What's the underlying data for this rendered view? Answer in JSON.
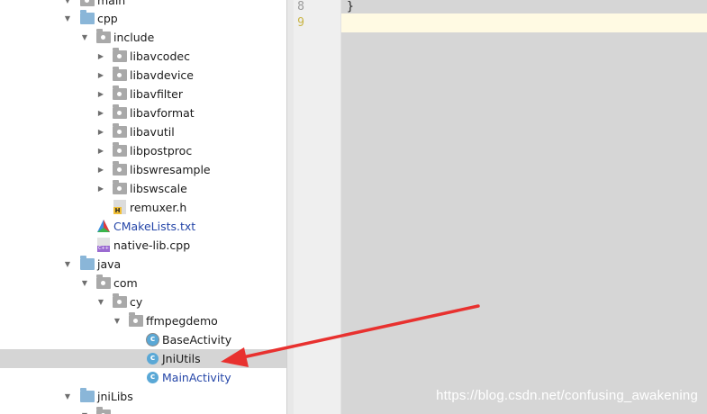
{
  "project_tree": {
    "items": [
      {
        "label": "main",
        "icon": "folder-gray-icon",
        "expanded": true
      },
      {
        "label": "cpp",
        "icon": "folder-blue-icon",
        "expanded": true
      },
      {
        "label": "include",
        "icon": "folder-gray-icon",
        "expanded": true
      },
      {
        "label": "libavcodec",
        "icon": "package-folder-icon",
        "expanded": false
      },
      {
        "label": "libavdevice",
        "icon": "package-folder-icon",
        "expanded": false
      },
      {
        "label": "libavfilter",
        "icon": "package-folder-icon",
        "expanded": false
      },
      {
        "label": "libavformat",
        "icon": "package-folder-icon",
        "expanded": false
      },
      {
        "label": "libavutil",
        "icon": "package-folder-icon",
        "expanded": false
      },
      {
        "label": "libpostproc",
        "icon": "package-folder-icon",
        "expanded": false
      },
      {
        "label": "libswresample",
        "icon": "package-folder-icon",
        "expanded": false
      },
      {
        "label": "libswscale",
        "icon": "package-folder-icon",
        "expanded": false
      },
      {
        "label": "remuxer.h",
        "icon": "header-file-icon"
      },
      {
        "label": "CMakeLists.txt",
        "icon": "cmake-file-icon"
      },
      {
        "label": "native-lib.cpp",
        "icon": "cpp-file-icon"
      },
      {
        "label": "java",
        "icon": "folder-blue-icon",
        "expanded": true
      },
      {
        "label": "com",
        "icon": "package-folder-icon",
        "expanded": true
      },
      {
        "label": "cy",
        "icon": "package-folder-icon",
        "expanded": true
      },
      {
        "label": "ffmpegdemo",
        "icon": "package-folder-icon",
        "expanded": true
      },
      {
        "label": "BaseActivity",
        "icon": "class-icon"
      },
      {
        "label": "JniUtils",
        "icon": "class-icon",
        "selected": true
      },
      {
        "label": "MainActivity",
        "icon": "class-icon"
      },
      {
        "label": "jniLibs",
        "icon": "folder-blue-icon",
        "expanded": true
      }
    ]
  },
  "editor": {
    "lines": [
      {
        "number": "8",
        "code": "}"
      },
      {
        "number": "9",
        "code": "",
        "current": true
      }
    ]
  },
  "annotation": {
    "color": "#e8312f"
  },
  "watermark": "https://blog.csdn.net/confusing_awakening",
  "colors": {
    "selection": "#d5d5d5",
    "current_line": "#fffae3",
    "class_icon": "#5aa8d6"
  }
}
